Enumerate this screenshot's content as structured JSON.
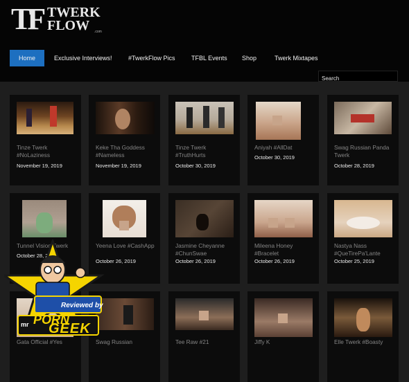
{
  "logo": {
    "mark": "TF",
    "line1": "TWERK",
    "line2": "FLOW",
    "suffix": ".com"
  },
  "nav": [
    "Home",
    "Exclusive Interviews!",
    "#TwerkFlow Pics",
    "TFBL Events",
    "Shop",
    "Twerk Mixtapes"
  ],
  "search": {
    "placeholder": "Search"
  },
  "cards": [
    {
      "title": "Tinze Twerk #NoLaziness",
      "date": "November 19, 2019"
    },
    {
      "title": "Keke Tha Goddess #Nameless",
      "date": "November 19, 2019"
    },
    {
      "title": "Tinze Twerk #TruthHurts",
      "date": "October 30, 2019"
    },
    {
      "title": "Aniyah #AllDat",
      "date": "October 30, 2019"
    },
    {
      "title": "Swag Russian Panda Twerk",
      "date": "October 28, 2019"
    },
    {
      "title": "Tunnel Vision Twerk",
      "date": "October 28, 2019"
    },
    {
      "title": "Yeena Love #CashApp",
      "date": "October 26, 2019"
    },
    {
      "title": "Jasmine Cheyanne #ChunSwae",
      "date": "October 26, 2019"
    },
    {
      "title": "Mileena Honey #Bracelet",
      "date": "October 26, 2019"
    },
    {
      "title": "Nastya Nass #QueTirePa'Lante",
      "date": "October 25, 2019"
    },
    {
      "title": "Gata Official #Yes",
      "date": ""
    },
    {
      "title": "Swag Russian",
      "date": ""
    },
    {
      "title": "Tee Raw #21",
      "date": ""
    },
    {
      "title": "Jiffy K",
      "date": ""
    },
    {
      "title": "Elle Twerk #Boasty",
      "date": ""
    }
  ],
  "badge": {
    "line1": "Reviewed by",
    "brand_left": "mr",
    "brand_main": "PORN",
    "brand_bottom": "GEEK"
  },
  "colors": {
    "accent": "#1d6fc0",
    "background": "#1e1e1e",
    "header": "#050505",
    "card": "#0c0c0c",
    "badge_yellow": "#f5d400",
    "badge_blue": "#1e4fa8"
  }
}
